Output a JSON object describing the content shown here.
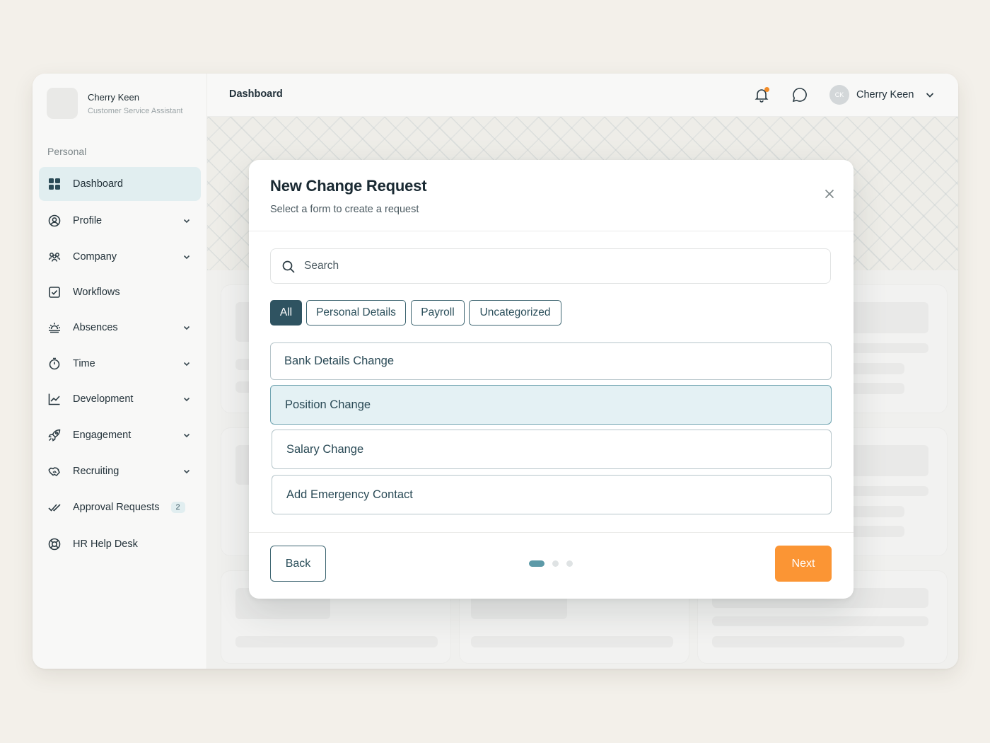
{
  "sidebar": {
    "user_name": "Cherry Keen",
    "user_role": "Customer Service Assistant",
    "section_label": "Personal",
    "items": [
      {
        "label": "Dashboard",
        "icon": "grid-icon",
        "active": true
      },
      {
        "label": "Profile",
        "icon": "user-circle-icon",
        "chevron": true
      },
      {
        "label": "Company",
        "icon": "people-icon",
        "chevron": true
      },
      {
        "label": "Workflows",
        "icon": "checkbox-icon"
      },
      {
        "label": "Absences",
        "icon": "sunrise-icon",
        "chevron": true
      },
      {
        "label": "Time",
        "icon": "stopwatch-icon",
        "chevron": true
      },
      {
        "label": "Development",
        "icon": "chart-line-icon",
        "chevron": true
      },
      {
        "label": "Engagement",
        "icon": "rocket-icon",
        "chevron": true
      },
      {
        "label": "Recruiting",
        "icon": "handshake-icon",
        "chevron": true
      },
      {
        "label": "Approval Requests",
        "icon": "double-check-icon",
        "badge": "2"
      },
      {
        "label": "HR Help Desk",
        "icon": "lifebuoy-icon"
      }
    ]
  },
  "header": {
    "title": "Dashboard",
    "user_initials": "CK",
    "user_name": "Cherry Keen",
    "notification_dot_color": "#f28c28"
  },
  "modal": {
    "title": "New Change Request",
    "subtitle": "Select a form to create a request",
    "search_placeholder": "Search",
    "filters": [
      {
        "label": "All",
        "active": true
      },
      {
        "label": "Personal Details",
        "active": false
      },
      {
        "label": "Payroll",
        "active": false
      },
      {
        "label": "Uncategorized",
        "active": false
      }
    ],
    "options": [
      {
        "label": "Bank Details Change",
        "selected": false
      },
      {
        "label": "Position Change",
        "selected": true
      },
      {
        "label": "Salary Change",
        "selected": false
      },
      {
        "label": "Add Emergency Contact",
        "selected": false
      }
    ],
    "back_label": "Back",
    "next_label": "Next",
    "pagination": {
      "current": 1,
      "total": 3
    }
  },
  "colors": {
    "accent": "#2f5361",
    "primary_button": "#fb9534",
    "selected_option": "#e4f1f4"
  }
}
